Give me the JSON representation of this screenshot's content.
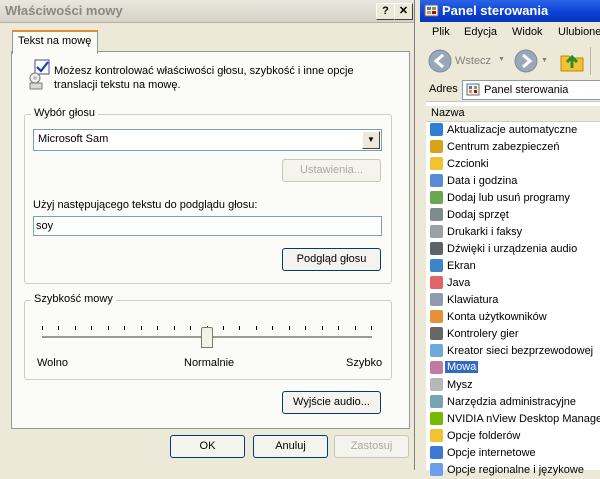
{
  "dialog": {
    "title": "Właściwości mowy",
    "help_glyph": "?",
    "close_glyph": "✕",
    "tab_label": "Tekst na mowę",
    "intro_text": "Możesz kontrolować właściwości głosu, szybkość i inne opcje translacji tekstu na mowę.",
    "voice_group": {
      "label": "Wybór głosu",
      "selected_voice": "Microsoft Sam",
      "settings_button": "Ustawienia...",
      "preview_label": "Użyj następującego tekstu do podglądu głosu:",
      "preview_text": "soy",
      "preview_button": "Podgląd głosu"
    },
    "speed_group": {
      "label": "Szybkość mowy",
      "min_label": "Wolno",
      "mid_label": "Normalnie",
      "max_label": "Szybko",
      "value_fraction": 0.5
    },
    "audio_output_button": "Wyjście audio...",
    "footer": {
      "ok": "OK",
      "cancel": "Anuluj",
      "apply": "Zastosuj"
    }
  },
  "control_panel": {
    "title": "Panel sterowania",
    "menu": [
      "Plik",
      "Edycja",
      "Widok",
      "Ulubione"
    ],
    "back_label": "Wstecz",
    "address_label": "Adres",
    "address_value": "Panel sterowania",
    "column_header": "Nazwa",
    "items": [
      {
        "label": "Aktualizacje automatyczne",
        "icon": "globe-update-icon",
        "color": "#2f7fd6"
      },
      {
        "label": "Centrum zabezpieczeń",
        "icon": "shield-icon",
        "color": "#d8a21b"
      },
      {
        "label": "Czcionki",
        "icon": "fonts-folder-icon",
        "color": "#f1c232"
      },
      {
        "label": "Data i godzina",
        "icon": "clock-icon",
        "color": "#5b8bd6"
      },
      {
        "label": "Dodaj lub usuń programy",
        "icon": "programs-icon",
        "color": "#6aa84f"
      },
      {
        "label": "Dodaj sprzęt",
        "icon": "hardware-icon",
        "color": "#7f8c8d"
      },
      {
        "label": "Drukarki i faksy",
        "icon": "printer-icon",
        "color": "#9aa0a6"
      },
      {
        "label": "Dźwięki i urządzenia audio",
        "icon": "speaker-icon",
        "color": "#5f6368"
      },
      {
        "label": "Ekran",
        "icon": "monitor-icon",
        "color": "#3d85c6"
      },
      {
        "label": "Java",
        "icon": "java-icon",
        "color": "#e06666"
      },
      {
        "label": "Klawiatura",
        "icon": "keyboard-icon",
        "color": "#8e9aaf"
      },
      {
        "label": "Konta użytkowników",
        "icon": "users-icon",
        "color": "#e69138"
      },
      {
        "label": "Kontrolery gier",
        "icon": "gamepad-icon",
        "color": "#666666"
      },
      {
        "label": "Kreator sieci bezprzewodowej",
        "icon": "wireless-icon",
        "color": "#6fa8dc"
      },
      {
        "label": "Mowa",
        "icon": "speech-icon",
        "color": "#c27ba0",
        "selected": true
      },
      {
        "label": "Mysz",
        "icon": "mouse-icon",
        "color": "#b7b7b7"
      },
      {
        "label": "Narzędzia administracyjne",
        "icon": "admin-tools-icon",
        "color": "#76a5af"
      },
      {
        "label": "NVIDIA nView Desktop Manager",
        "icon": "nvidia-icon",
        "color": "#76b900"
      },
      {
        "label": "Opcje folderów",
        "icon": "folder-options-icon",
        "color": "#f1c232"
      },
      {
        "label": "Opcje internetowe",
        "icon": "internet-options-icon",
        "color": "#3c78d8"
      },
      {
        "label": "Opcje regionalne i językowe",
        "icon": "regional-icon",
        "color": "#6d9eeb"
      }
    ]
  }
}
